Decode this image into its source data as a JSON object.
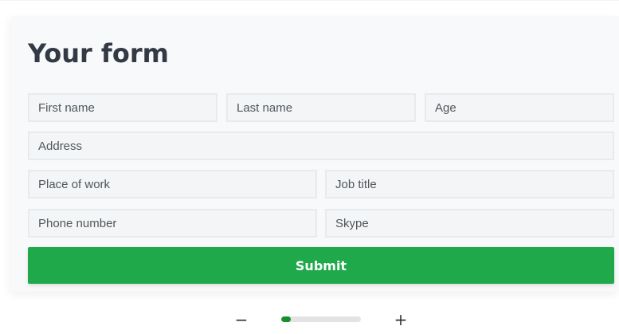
{
  "form": {
    "title": "Your form",
    "fields": {
      "first_name": {
        "placeholder": "First name",
        "value": ""
      },
      "last_name": {
        "placeholder": "Last name",
        "value": ""
      },
      "age": {
        "placeholder": "Age",
        "value": ""
      },
      "address": {
        "placeholder": "Address",
        "value": ""
      },
      "place_of_work": {
        "placeholder": "Place of work",
        "value": ""
      },
      "job_title": {
        "placeholder": "Job title",
        "value": ""
      },
      "phone_number": {
        "placeholder": "Phone number",
        "value": ""
      },
      "skype": {
        "placeholder": "Skype",
        "value": ""
      }
    },
    "submit_label": "Submit"
  },
  "zoom": {
    "minus_label": "−",
    "plus_label": "+",
    "level_fraction": 0.12
  },
  "colors": {
    "accent": "#1fa94b",
    "zoom_fill": "#178f2c",
    "title": "#343a45"
  }
}
